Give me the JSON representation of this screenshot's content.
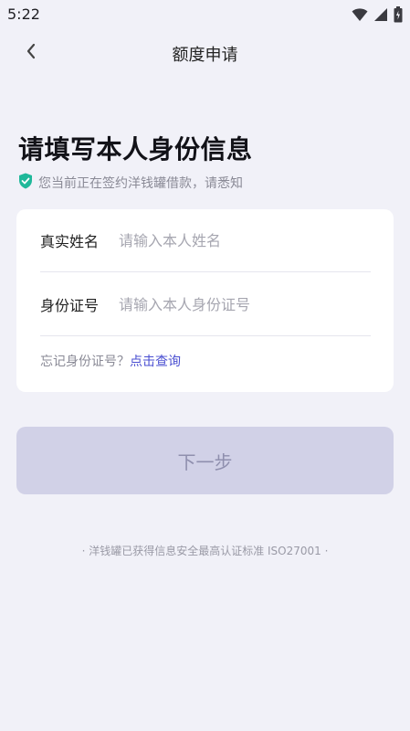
{
  "status_bar": {
    "time": "5:22",
    "icons": [
      "wifi-icon",
      "signal-icon",
      "battery-icon"
    ]
  },
  "nav": {
    "title": "额度申请",
    "back_icon": "chevron-left-icon"
  },
  "page": {
    "heading": "请填写本人身份信息",
    "notice": "您当前正在签约洋钱罐借款，请悉知",
    "notice_icon": "shield-check-icon"
  },
  "form": {
    "name": {
      "label": "真实姓名",
      "placeholder": "请输入本人姓名",
      "value": ""
    },
    "id": {
      "label": "身份证号",
      "placeholder": "请输入本人身份证号",
      "value": ""
    },
    "forgot_text": "忘记身份证号？",
    "forgot_link": "点击查询"
  },
  "actions": {
    "next_label": "下一步"
  },
  "footer": {
    "note": "· 洋钱罐已获得信息安全最高认证标准 ISO27001 ·"
  },
  "colors": {
    "background": "#f1f1f8",
    "card": "#ffffff",
    "accent_link": "#4a4fd1",
    "shield": "#1fb89a",
    "button_disabled_bg": "#d1d1e7",
    "button_disabled_text": "#8f8fae"
  }
}
